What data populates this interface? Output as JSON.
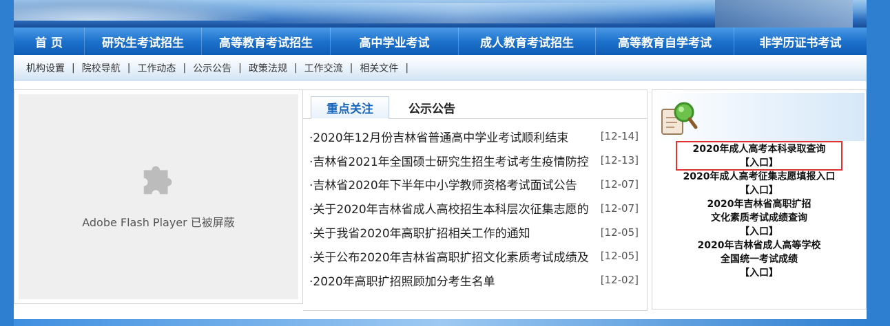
{
  "nav": {
    "items": [
      {
        "label": "首 页",
        "width": 103
      },
      {
        "label": "研究生考试招生",
        "width": 170
      },
      {
        "label": "高等教育考试招生",
        "width": 187
      },
      {
        "label": "高中学业考试",
        "width": 186
      },
      {
        "label": "成人教育考试招生",
        "width": 199
      },
      {
        "label": "高等教育自学考试",
        "width": 201
      },
      {
        "label": "非学历证书考试",
        "width": 192
      }
    ]
  },
  "subnav": {
    "items": [
      "机构设置",
      "院校导航",
      "工作动态",
      "公示公告",
      "政策法规",
      "工作交流",
      "相关文件"
    ],
    "separator": "|"
  },
  "flash": {
    "message": "Adobe Flash Player 已被屏蔽"
  },
  "news": {
    "tabs": [
      "重点关注",
      "公示公告"
    ],
    "items": [
      {
        "title": "·2020年12月份吉林省普通高中学业考试顺利结束",
        "date": "[12-14]"
      },
      {
        "title": "·吉林省2021年全国硕士研究生招生考试考生疫情防控",
        "date": "[12-13]"
      },
      {
        "title": "·吉林省2020年下半年中小学教师资格考试面试公告",
        "date": "[12-07]"
      },
      {
        "title": "·关于2020年吉林省成人高校招生本科层次征集志愿的",
        "date": "[12-07]"
      },
      {
        "title": "·关于我省2020年高职扩招相关工作的通知",
        "date": "[12-05]"
      },
      {
        "title": "·关于公布2020年吉林省高职扩招文化素质考试成绩及",
        "date": "[12-05]"
      },
      {
        "title": "·2020年高职扩招照顾加分考生名单",
        "date": "[12-02]"
      }
    ]
  },
  "query": {
    "lines": [
      "2020年成人高考本科录取查询",
      "【入口】",
      "2020年成人高考征集志愿填报入口",
      "【入口】",
      "2020年吉林省高职扩招",
      "文化素质考试成绩查询",
      "【入口】",
      "2020年吉林省成人高等学校",
      "全国统一考试成绩",
      "【入口】"
    ]
  },
  "colors": {
    "nav_blue": "#1d72cc",
    "tab_active": "#1a66bb",
    "highlight": "#e03030",
    "page_bg": "#2f7fd0"
  }
}
